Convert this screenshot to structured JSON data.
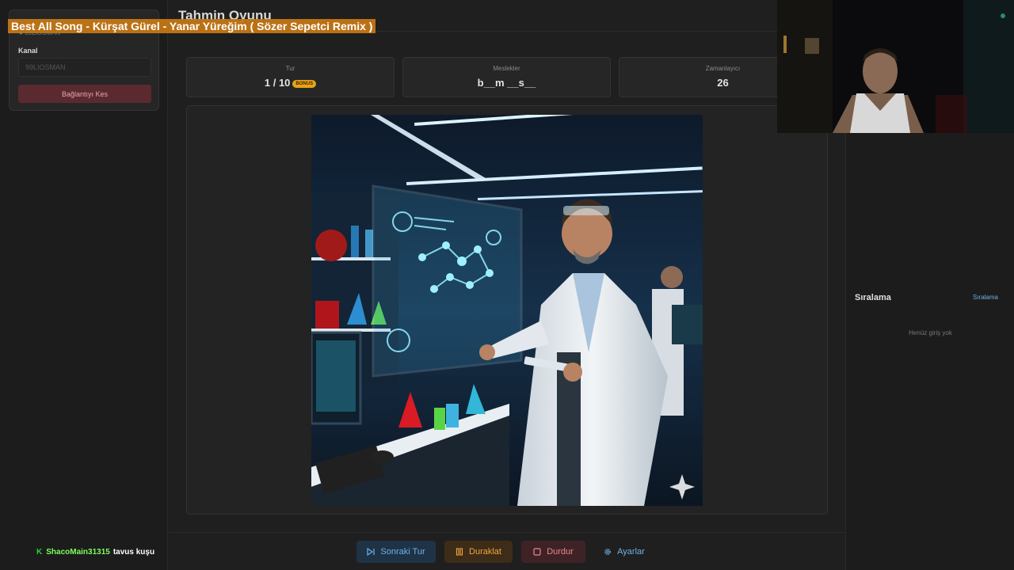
{
  "sidebar": {
    "connected_user": "99LIOSMAN",
    "channel_label": "Kanal",
    "channel_value": "99LIOSMAN",
    "disconnect_label": "Bağlantıyı Kes"
  },
  "header": {
    "title": "Tahmin Oyunu"
  },
  "stats": {
    "round_label": "Tur",
    "round_value": "1 / 10",
    "bonus_badge": "BONUS",
    "category_label": "Meslekler",
    "hint_value": "b__m __s__",
    "timer_label": "Zamanlayıcı",
    "timer_value": "26"
  },
  "image": {
    "icon": "sparkle-icon"
  },
  "actions": {
    "next_label": "Sonraki Tur",
    "pause_label": "Duraklat",
    "stop_label": "Durdur",
    "settings_label": "Ayarlar"
  },
  "ranking": {
    "title": "Sıralama",
    "link": "Sıralama",
    "empty": "Henüz giriş yok"
  },
  "overlay": {
    "song": "Best All Song - Kürşat Gürel - Yanar Yüreğim ( Sözer Sepetci Remix )"
  },
  "chat": {
    "badge": "K",
    "user": "ShacoMain31315",
    "message": "tavus kuşu"
  },
  "colors": {
    "accent_blue": "#6fb0e8",
    "pause_orange": "#f0a640",
    "stop_red": "#e88894",
    "bonus_gold": "#e8a317",
    "chat_green": "#7fff5a"
  }
}
